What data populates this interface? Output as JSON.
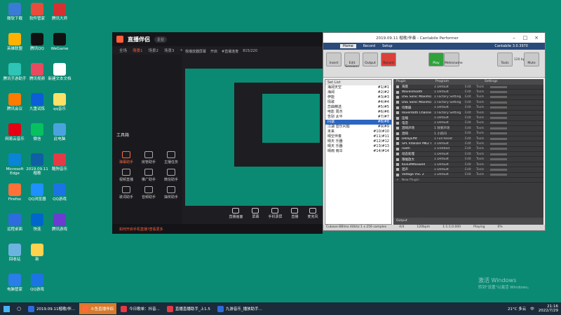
{
  "desktop_icons": [
    {
      "label": "微软下载",
      "color": "#3a7bd5"
    },
    {
      "label": "软件管家",
      "color": "#e94b3c"
    },
    {
      "label": "腾讯大师",
      "color": "#d63031"
    },
    {
      "label": "英雄联盟",
      "color": "#ffb000"
    },
    {
      "label": "腾讯QQ",
      "color": "#111"
    },
    {
      "label": "WeGame",
      "color": "#111"
    },
    {
      "label": "腾讯手游助手",
      "color": "#2ec4b6"
    },
    {
      "label": "腾讯视频",
      "color": "#e84a5f"
    },
    {
      "label": "新建文本文档",
      "color": "#ffffff"
    },
    {
      "label": "腾讯会议",
      "color": "#ff7b00"
    },
    {
      "label": "九重试炼",
      "color": "#0b5ed7"
    },
    {
      "label": "qq音乐",
      "color": "#ffe066"
    },
    {
      "label": "网易云音乐",
      "color": "#e60012"
    },
    {
      "label": "微信",
      "color": "#07c160"
    },
    {
      "label": "此电脑",
      "color": "#4aa3df"
    },
    {
      "label": "Microsoft Edge",
      "color": "#0a84d6"
    },
    {
      "label": "2019.09.11楷歌",
      "color": "#0f5fa5"
    },
    {
      "label": "酷狗音乐",
      "color": "#e63946"
    },
    {
      "label": "Firefox",
      "color": "#ff7139"
    },
    {
      "label": "QQ浏览器",
      "color": "#1e90ff"
    },
    {
      "label": "QQ游戏",
      "color": "#1b74e4"
    },
    {
      "label": "远程桌面",
      "color": "#2d6cdf"
    },
    {
      "label": "快连",
      "color": "#0066cc"
    },
    {
      "label": "腾讯游戏",
      "color": "#6c3bd1"
    },
    {
      "label": "回收站",
      "color": "#6cb4e0"
    },
    {
      "label": "新",
      "color": "#ffd24d"
    },
    {
      "label": "电脑管家",
      "color": "#2b7de9"
    },
    {
      "label": "QQ游戏",
      "color": "#1b74e4"
    }
  ],
  "live_app": {
    "brand": "直播伴侣",
    "badge": "企业",
    "tabs": [
      "全场",
      "场景1",
      "场景2",
      "场景3"
    ],
    "scene_items": [
      "我播放器屏幕",
      "开启",
      "#直播连麦"
    ],
    "counter": "815/220",
    "section_title": "工具箱",
    "tools": [
      {
        "label": "弹幕助手",
        "hot": true
      },
      {
        "label": "房管助手",
        "hot": false
      },
      {
        "label": "主播任务",
        "hot": false
      },
      {
        "label": "视频直播",
        "hot": false
      },
      {
        "label": "推广助手",
        "hot": false
      },
      {
        "label": "微信助手",
        "hot": false
      },
      {
        "label": "歌词助手",
        "hot": false
      },
      {
        "label": "音频助手",
        "hot": false
      },
      {
        "label": "抽奖助手",
        "hot": false
      }
    ],
    "bottom_actions": [
      "直播画面",
      "屏幕",
      "手机录屏",
      "直播",
      "麦克风"
    ],
    "status_line": "如何开启手机直播?查看更多"
  },
  "cantabile": {
    "title": "2019.09.11 楷歌/伴奏 - Cantabile Performer",
    "menus": [
      "Home",
      "Record",
      "Setup"
    ],
    "version": "Cantabile 3.0.3970",
    "ribbon_labels": [
      "Insert",
      "Edit Sessions",
      "Output",
      "Record",
      "Play",
      "Metronome",
      "Tools",
      "Mute"
    ],
    "tempo": "120 bpm",
    "songs_header": "Set List",
    "songs": [
      {
        "name": "海阔天空",
        "key": "#1/#1"
      },
      {
        "name": "海阔",
        "key": "#2/#2"
      },
      {
        "name": "伊能",
        "key": "#3/#3"
      },
      {
        "name": "情歌",
        "key": "#4/#4"
      },
      {
        "name": "恋曲精选",
        "key": "#5/#5"
      },
      {
        "name": "电影 周杰",
        "key": "#6/#6"
      },
      {
        "name": "告别 太平",
        "key": "#7/#7"
      },
      {
        "name": "闪退",
        "key": "#8/#8"
      },
      {
        "name": "江湖 音乐问题",
        "key": "#9/#9"
      },
      {
        "name": "未来",
        "key": "#10/#10"
      },
      {
        "name": "晴空伴奏",
        "key": "#11/#11"
      },
      {
        "name": "晴天 乐器",
        "key": "#12/#12"
      },
      {
        "name": "晴天 乐器",
        "key": "#13/#13"
      },
      {
        "name": "晴雨 雨伞",
        "key": "#14/#14"
      }
    ],
    "selected_song": 7,
    "rack_header": [
      "Plugin",
      "Program",
      "Settings"
    ],
    "plugins": [
      {
        "name": "海底",
        "program": "1 Default"
      },
      {
        "name": "Wavesmooth",
        "program": "1 Default"
      },
      {
        "name": "DSE Sonic Maximiz",
        "program": "1 Factory Setting"
      },
      {
        "name": "DSE Sonic Maximiz",
        "program": "1 Factory Setting"
      },
      {
        "name": "均衡器",
        "program": "1 Default"
      },
      {
        "name": "RoverRoth Channel",
        "program": "1 Factory Setting"
      },
      {
        "name": "压缩",
        "program": "1 Default"
      },
      {
        "name": "电音",
        "program": "1 Default"
      },
      {
        "name": "混响声场",
        "program": "1 效果声场"
      },
      {
        "name": "混响",
        "program": "1 小房间"
      },
      {
        "name": "DelayEffit",
        "program": "1 Full Reset"
      },
      {
        "name": "SPL Vitalizer MK2 T",
        "program": "1 Default"
      },
      {
        "name": "rooth",
        "program": "1 Untitled"
      },
      {
        "name": "动态处理",
        "program": "1 Default"
      },
      {
        "name": "限幅放大",
        "program": "1 Default"
      },
      {
        "name": "KoiluMMaxwell",
        "program": "1 Default"
      },
      {
        "name": "混声",
        "program": "1 Default"
      },
      {
        "name": "Voltage VSC 2",
        "program": "1 Default"
      }
    ],
    "edit_label": "Edit",
    "tools_label": "Tools",
    "new_plugin": "New Plugin",
    "output_label": "Output",
    "status": [
      "Cubase BBlmx 44khz 1 x 256 samples",
      "4/4",
      "120bpm",
      "1:1:1:0.000",
      "Playing",
      "0%"
    ]
  },
  "taskbar": {
    "tasks": [
      {
        "label": "2019.09.11楷歌/伴...",
        "color": "#2d6cdf",
        "active": false
      },
      {
        "label": "斗鱼直播伴侣",
        "color": "#ff6a3d",
        "active": true
      },
      {
        "label": "今日歌单：抖音...",
        "color": "#e63946",
        "active": false
      },
      {
        "label": "直播直播助手_上1.5",
        "color": "#e63946",
        "active": false
      },
      {
        "label": "九游音乐_播放助手...",
        "color": "#2d6cdf",
        "active": false
      }
    ],
    "weather": "21°C 多云",
    "lang": "中",
    "time": "21:16",
    "date": "2022/7/29"
  },
  "watermark": {
    "line1": "激活 Windows",
    "line2": "转到\"设置\"以激活 Windows。"
  }
}
